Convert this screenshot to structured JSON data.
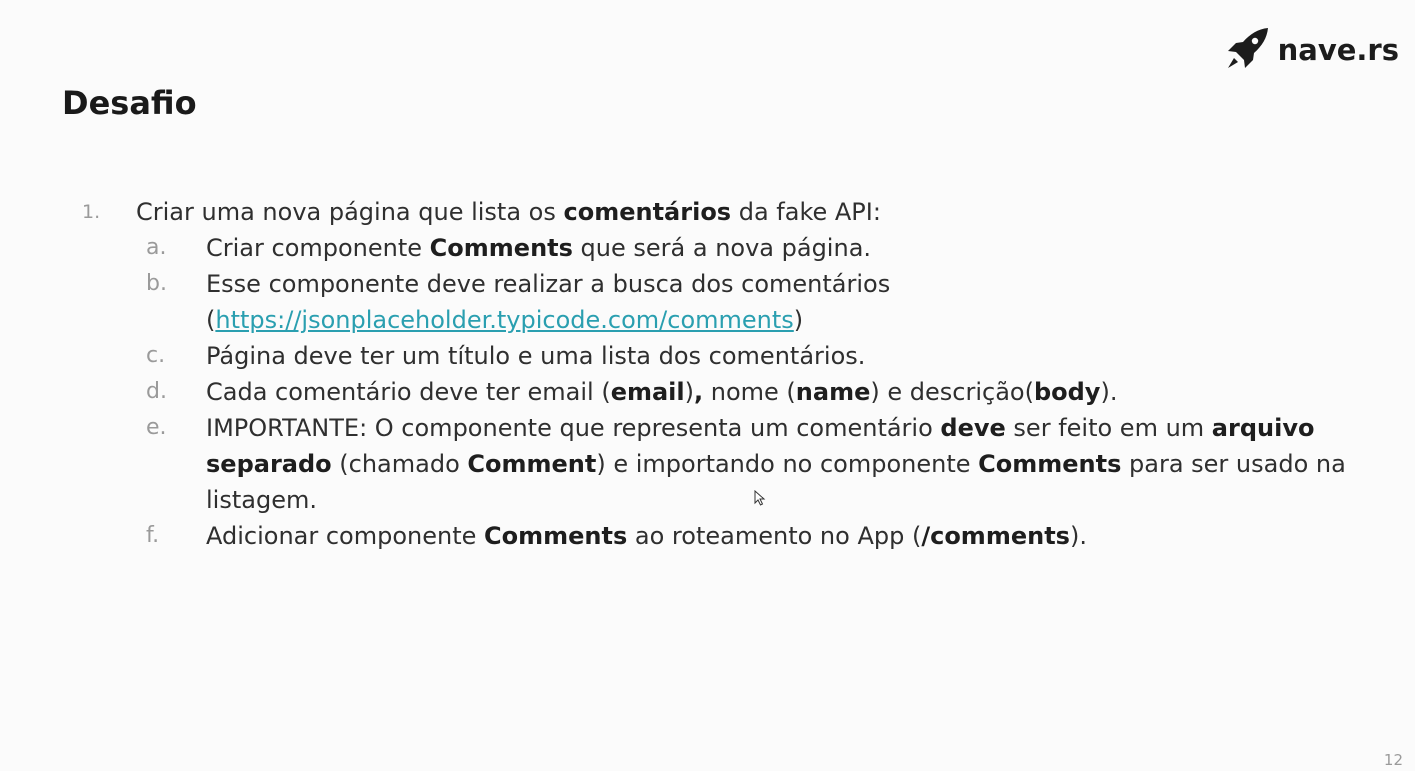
{
  "logo": {
    "text": "nave.rs",
    "icon": "rocket-icon"
  },
  "title": "Desafio",
  "list": {
    "number": "1.",
    "intro": {
      "before": "Criar uma nova página que lista os ",
      "bold": "comentários",
      "after": " da fake API:"
    },
    "items": {
      "a": {
        "letter": "a.",
        "before": "Criar componente ",
        "bold": "Comments",
        "after": " que será a nova página."
      },
      "b": {
        "letter": "b.",
        "text": "Esse componente deve realizar a busca dos comentários",
        "open_paren": "(",
        "link": "https://jsonplaceholder.typicode.com/comments",
        "close_paren": ")"
      },
      "c": {
        "letter": "c.",
        "text": "Página deve ter um título e uma lista dos comentários."
      },
      "d": {
        "letter": "d.",
        "t1": "Cada comentário deve ter email (",
        "b1": "email",
        "t2": "), ",
        "t2b": ",",
        "t3": " nome (",
        "b2": "name",
        "t4": ") e descrição(",
        "b3": "body",
        "t5": ")."
      },
      "e": {
        "letter": "e.",
        "t1": "IMPORTANTE: O componente que representa um comentário ",
        "b1": "deve",
        "t2": " ser feito em um ",
        "b2": "arquivo separado",
        "t3": " (chamado ",
        "b3": "Comment",
        "t4": ") e importando no componente ",
        "b4": "Comments",
        "t5": " para ser usado na listagem."
      },
      "f": {
        "letter": "f.",
        "t1": "Adicionar componente ",
        "b1": "Comments",
        "t2": " ao roteamento no App (",
        "b2": "/comments",
        "t3": ")."
      }
    }
  },
  "page_number": "12",
  "colors": {
    "background": "#fbfbfb",
    "text": "#2f2f2f",
    "link": "#2a9fb0",
    "muted": "#9a9a9a"
  }
}
